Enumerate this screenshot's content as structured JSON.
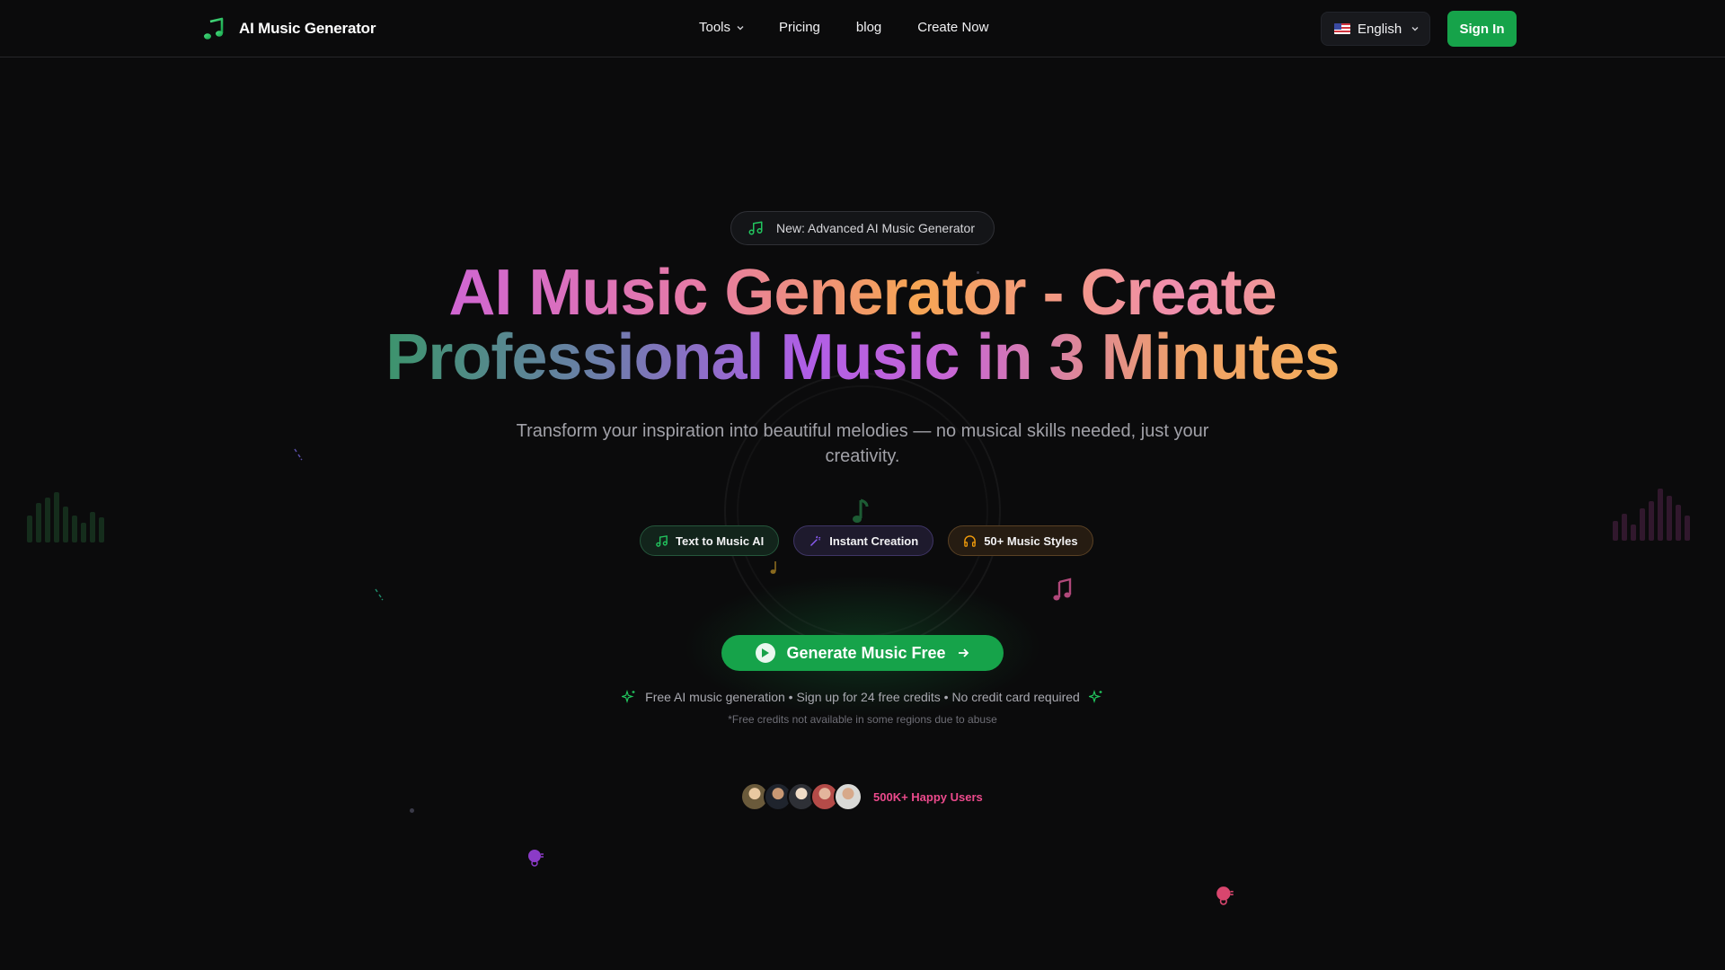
{
  "brand": {
    "name": "AI Music Generator",
    "icon": "music-note-icon",
    "accent": "#22c55e"
  },
  "nav": {
    "tools": "Tools",
    "pricing": "Pricing",
    "blog": "blog",
    "create": "Create Now"
  },
  "language": {
    "selected": "English",
    "flag": "us-flag-icon"
  },
  "signin": "Sign In",
  "hero": {
    "badge": "New: Advanced AI Music Generator",
    "headline_line1": "AI Music Generator - Create",
    "headline_line2": "Professional Music in 3 Minutes",
    "subtitle": "Transform your inspiration into beautiful melodies — no musical skills needed, just your creativity.",
    "chips": [
      {
        "label": "Text to Music AI",
        "icon": "music-note-icon",
        "color": "#22c55e"
      },
      {
        "label": "Instant Creation",
        "icon": "magic-wand-icon",
        "color": "#8b5cf6"
      },
      {
        "label": "50+ Music Styles",
        "icon": "headphones-icon",
        "color": "#f59e0b"
      }
    ],
    "cta": "Generate Music Free",
    "note": "Free AI music generation • Sign up for 24 free credits • No credit card required",
    "fine_print": "*Free credits not available in some regions due to abuse",
    "users_label": "500K+ Happy Users"
  },
  "colors": {
    "background": "#0b0b0c",
    "primary": "#16a34a",
    "pink": "#ec4a8c"
  }
}
